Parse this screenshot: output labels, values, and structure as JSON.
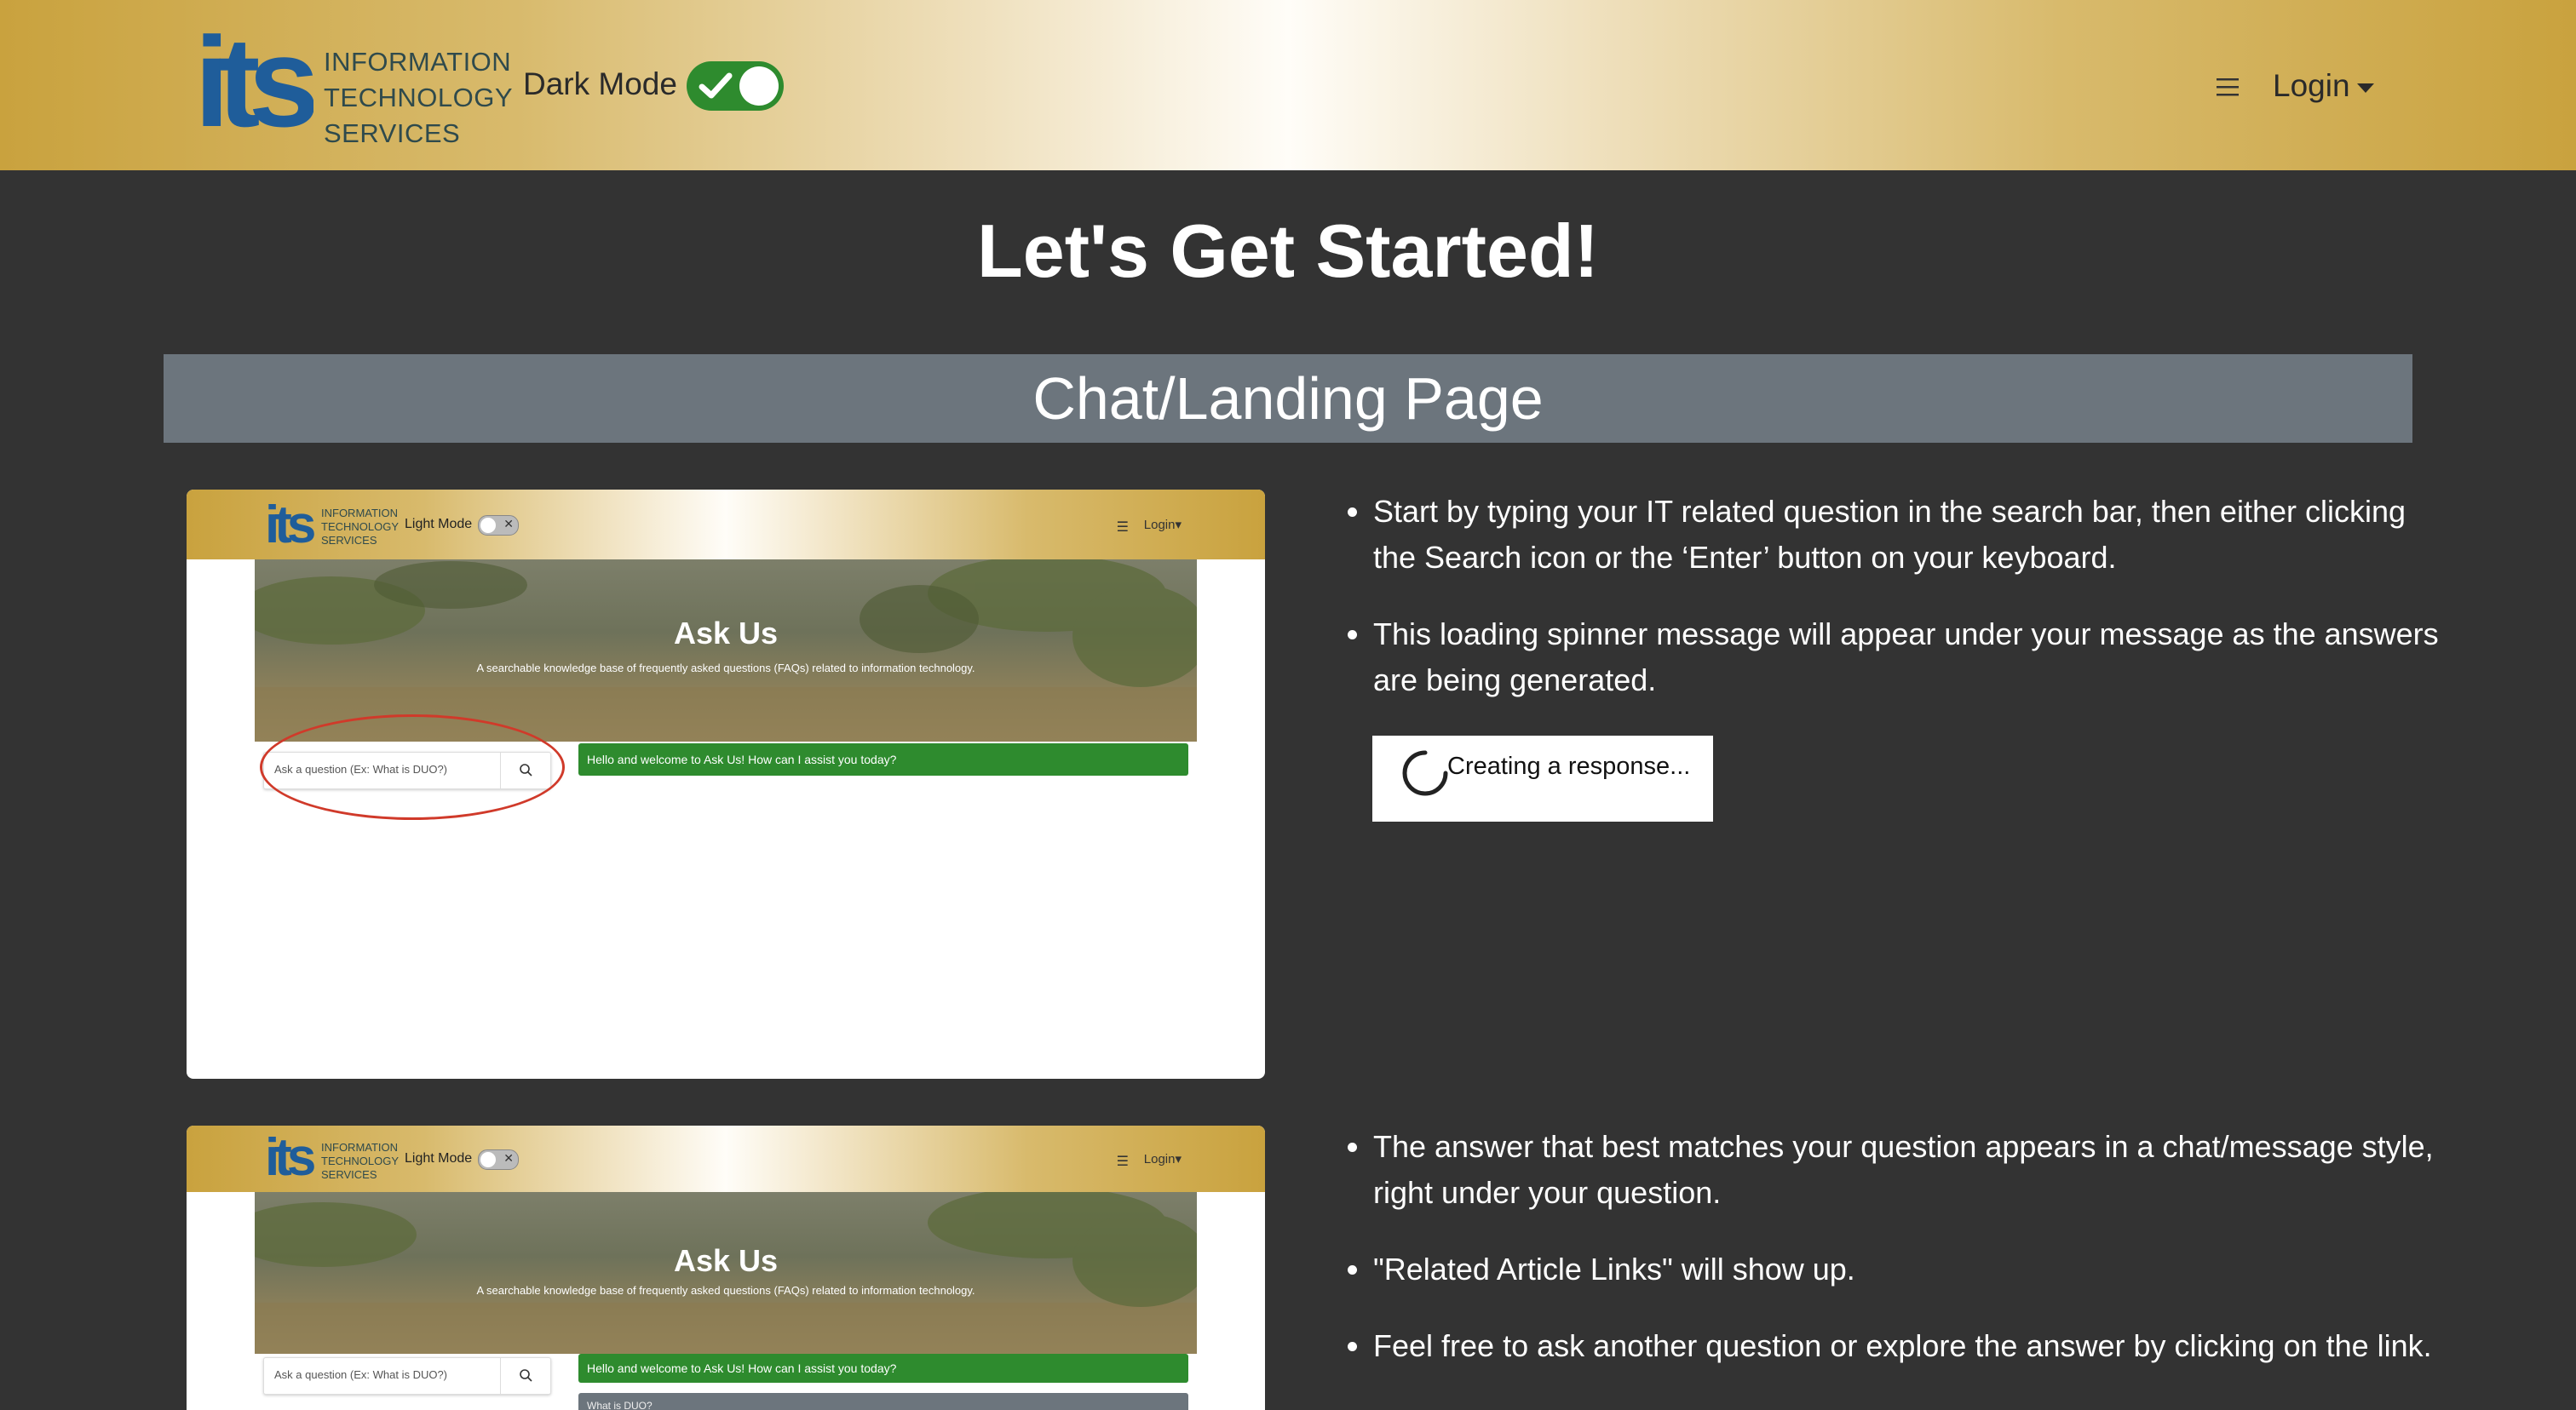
{
  "header": {
    "logo_letters": "its",
    "logo_text_lines": [
      "INFORMATION",
      "TECHNOLOGY",
      "SERVICES"
    ],
    "mode_label": "Dark Mode",
    "mode_on": true,
    "login_label": "Login"
  },
  "page_title": "Let's Get Started!",
  "section": {
    "title": "Chat/Landing Page"
  },
  "screenshot1": {
    "logo_text_lines": [
      "INFORMATION",
      "TECHNOLOGY",
      "SERVICES"
    ],
    "mode_label": "Light Mode",
    "login_label": "Login",
    "banner_title": "Ask Us",
    "banner_subtitle": "A searchable knowledge base of frequently asked questions (FAQs) related to information technology.",
    "search_placeholder": "Ask a question (Ex: What is DUO?)",
    "chat_message": "Hello and welcome to Ask Us! How can I assist you today?"
  },
  "screenshot2": {
    "logo_text_lines": [
      "INFORMATION",
      "TECHNOLOGY",
      "SERVICES"
    ],
    "mode_label": "Light Mode",
    "login_label": "Login",
    "banner_title": "Ask Us",
    "banner_subtitle": "A searchable knowledge base of frequently asked questions (FAQs) related to information technology.",
    "search_placeholder": "Ask a question (Ex: What is DUO?)",
    "chat_message": "Hello and welcome to Ask Us! How can I assist you today?",
    "user_message": "What is DUO?"
  },
  "instructions1": [
    "Start by typing your IT related question in the search bar, then either clicking the Search icon or the ‘Enter’ button on your keyboard.",
    "This loading spinner message will appear under your message as the answers are being generated."
  ],
  "spinner_text": "Creating a response...",
  "instructions2": [
    "The answer that best matches your question appears in a chat/message style, right under your question.",
    "\"Related Article Links\" will show up.",
    "Feel free to ask another question or explore the answer by clicking on the link."
  ],
  "colors": {
    "background": "#333333",
    "header_gold": "#c9a23e",
    "toggle_green": "#2e8b2e",
    "section_bar": "#6c757d",
    "logo_blue": "#1f5d9a",
    "highlight_red": "#d03a2a"
  }
}
